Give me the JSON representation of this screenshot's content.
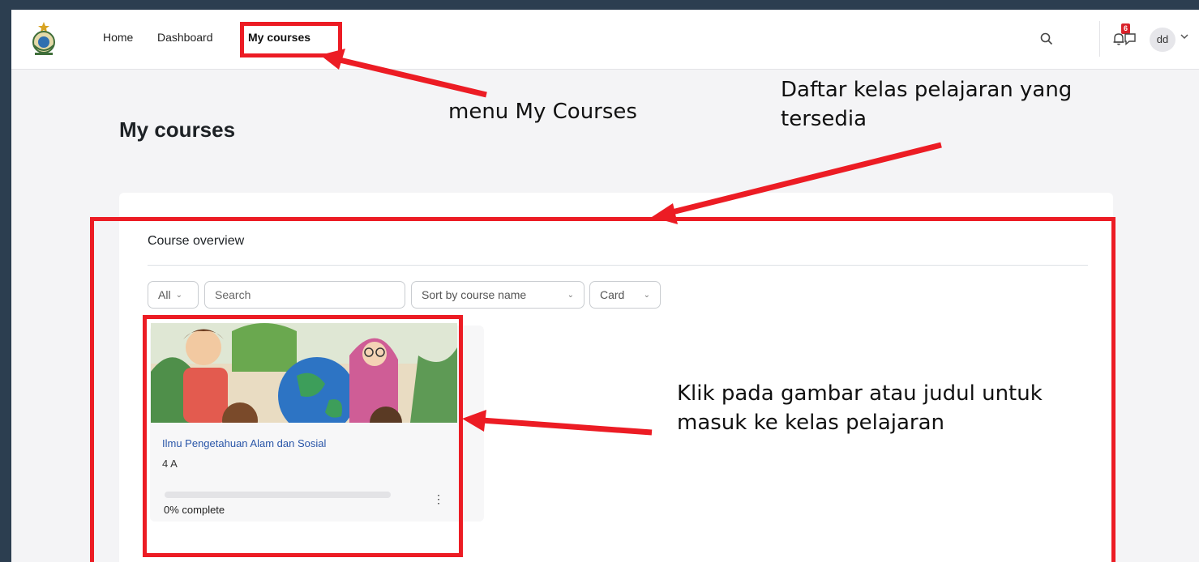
{
  "navbar": {
    "links": [
      "Home",
      "Dashboard",
      "My courses"
    ],
    "active_link": "My courses",
    "notification_count": "6",
    "user_initials": "dd",
    "icons": [
      "logo-emblem-icon",
      "search-icon",
      "bell-icon",
      "chat-icon",
      "chevron-down-icon"
    ]
  },
  "page": {
    "title": "My courses"
  },
  "overview": {
    "title": "Course overview",
    "filter_label": "All",
    "search_placeholder": "Search",
    "sort_label": "Sort by course name",
    "view_label": "Card"
  },
  "courses": [
    {
      "name": "Ilmu Pengetahuan Alam dan Sosial",
      "short_name": "4 A",
      "progress_percent": 0,
      "progress_text": "0% complete",
      "menu_glyph": "⋮"
    }
  ],
  "annotations": {
    "menu": "menu My Courses",
    "daftar": "Daftar kelas pelajaran yang tersedia",
    "klik": "Klik pada gambar atau judul untuk masuk ke kelas pelajaran"
  },
  "colors": {
    "annotation_red": "#ec1c24",
    "link_blue": "#2a56a8",
    "outer_background": "#2c3e50"
  }
}
